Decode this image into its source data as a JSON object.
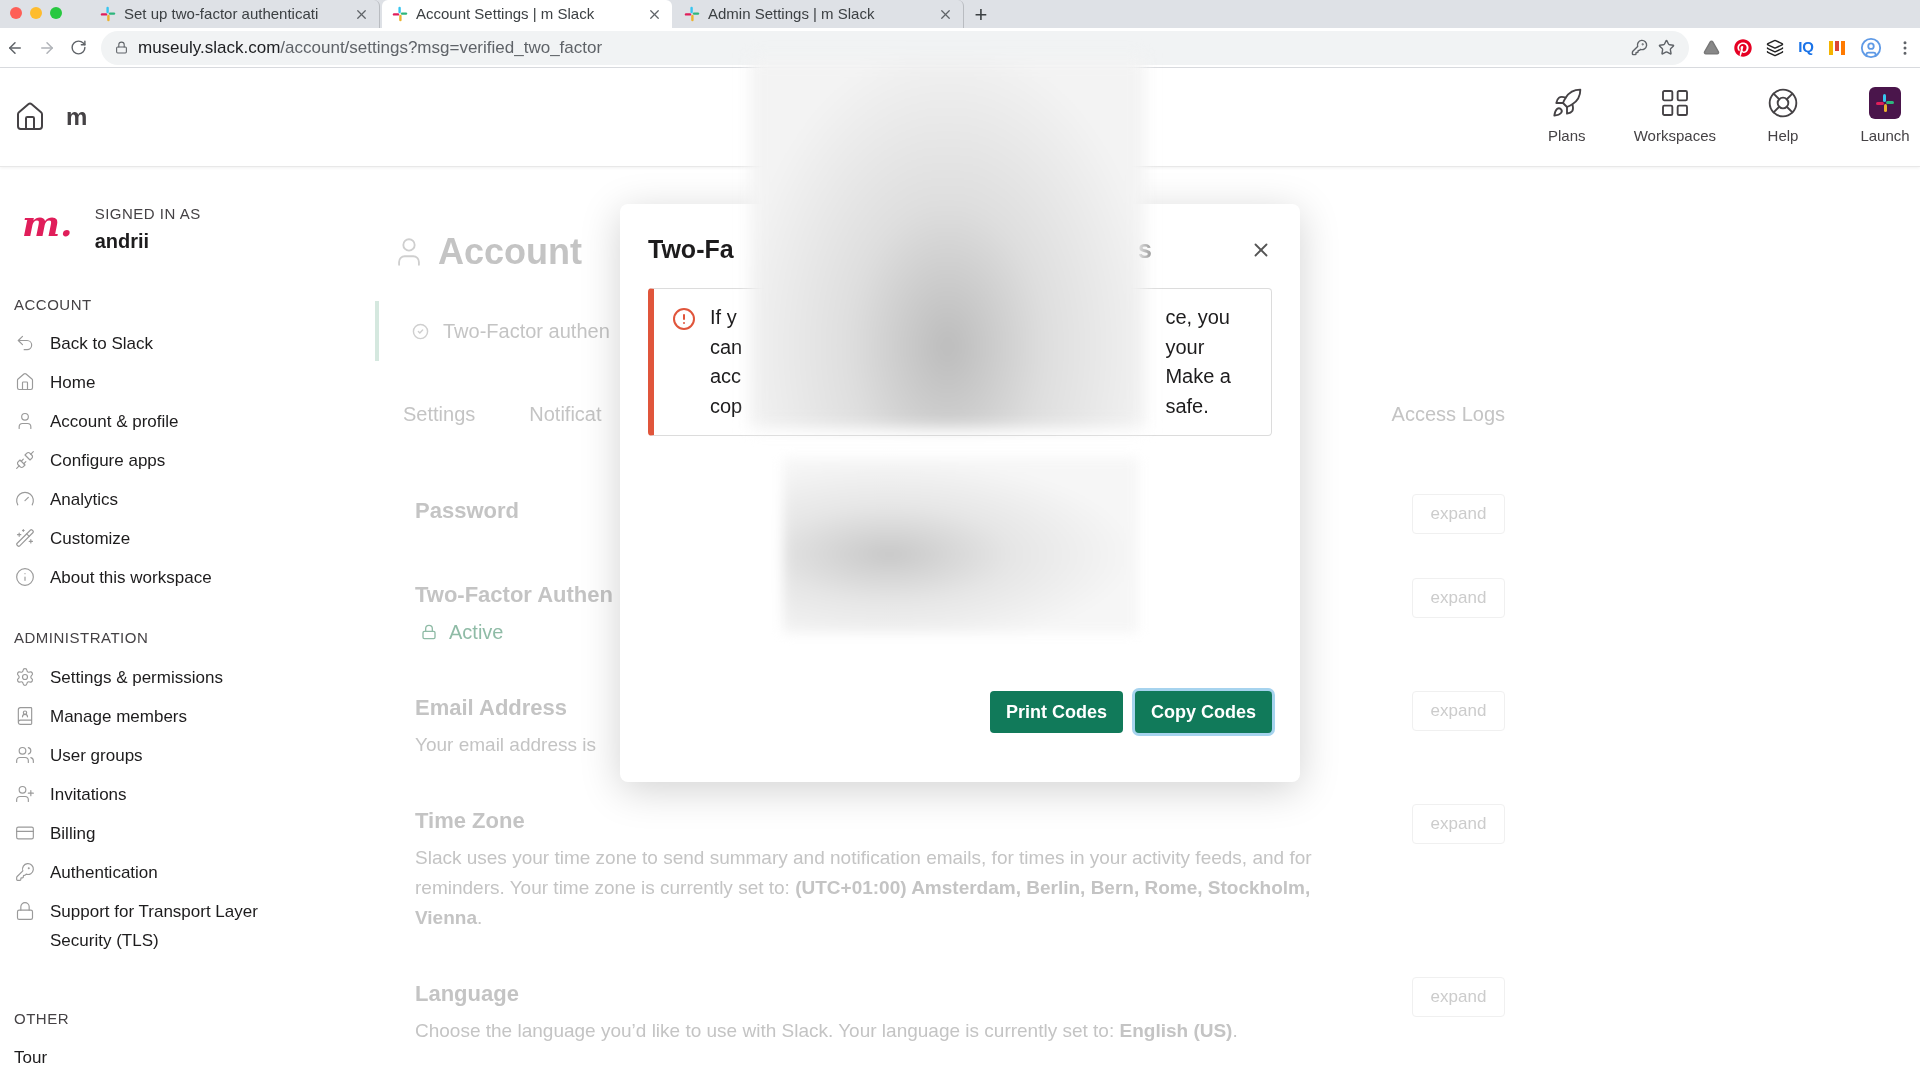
{
  "browser": {
    "tabs": [
      {
        "title": "Set up two-factor authenticati",
        "selected": false
      },
      {
        "title": "Account Settings | m Slack",
        "selected": true
      },
      {
        "title": "Admin Settings | m Slack",
        "selected": false
      }
    ],
    "new_tab": "+",
    "url_host": "museuly.slack.com",
    "url_path": "/account/settings?msg=verified_two_factor",
    "extension_label": "IQ"
  },
  "header": {
    "workspace": "m",
    "nav": [
      {
        "label": "Plans"
      },
      {
        "label": "Workspaces"
      },
      {
        "label": "Help"
      },
      {
        "label": "Launch"
      }
    ]
  },
  "sidebar": {
    "logo": "m.",
    "signed_in_label": "SIGNED IN AS",
    "user": "andrii",
    "sections": [
      {
        "heading": "ACCOUNT",
        "items": [
          {
            "label": "Back to Slack"
          },
          {
            "label": "Home"
          },
          {
            "label": "Account & profile"
          },
          {
            "label": "Configure apps"
          },
          {
            "label": "Analytics"
          },
          {
            "label": "Customize"
          },
          {
            "label": "About this workspace"
          }
        ]
      },
      {
        "heading": "ADMINISTRATION",
        "items": [
          {
            "label": "Settings & permissions"
          },
          {
            "label": "Manage members"
          },
          {
            "label": "User groups"
          },
          {
            "label": "Invitations"
          },
          {
            "label": "Billing"
          },
          {
            "label": "Authentication"
          },
          {
            "label": "Support for Transport Layer Security (TLS)"
          }
        ]
      },
      {
        "heading": "OTHER",
        "items": [
          {
            "label": "Tour"
          }
        ]
      }
    ]
  },
  "page": {
    "title": "Account",
    "banner": "Two-Factor authen",
    "tabs": [
      {
        "label": "Settings"
      },
      {
        "label": "Notificat"
      },
      {
        "label": "Access Logs"
      }
    ],
    "sections": [
      {
        "title": "Password",
        "expand": "expand"
      },
      {
        "title": "Two-Factor Authen",
        "status": "Active",
        "expand": "expand"
      },
      {
        "title": "Email Address",
        "description": "Your email address is",
        "expand": "expand"
      },
      {
        "title": "Time Zone",
        "description": "Slack uses your time zone to send summary and notification emails, for times in your activity feeds, and for reminders. Your time zone is currently set to: **(UTC+01:00) Amsterdam, Berlin, Bern, Rome, Stockholm, Vienna**.",
        "expand": "expand"
      },
      {
        "title": "Language",
        "description": "Choose the language you’d like to use with Slack. Your language is currently set to: **English (US)**.",
        "expand": "expand"
      }
    ]
  },
  "modal": {
    "title_parts": [
      "Two-Fa",
      "s"
    ],
    "warning_left": [
      "If y",
      "can",
      "acc",
      "cop"
    ],
    "warning_right": [
      "ce, you",
      "your",
      "Make a",
      "safe."
    ],
    "buttons": [
      {
        "label": "Print Codes",
        "focused": false
      },
      {
        "label": "Copy Codes",
        "focused": true
      }
    ]
  }
}
